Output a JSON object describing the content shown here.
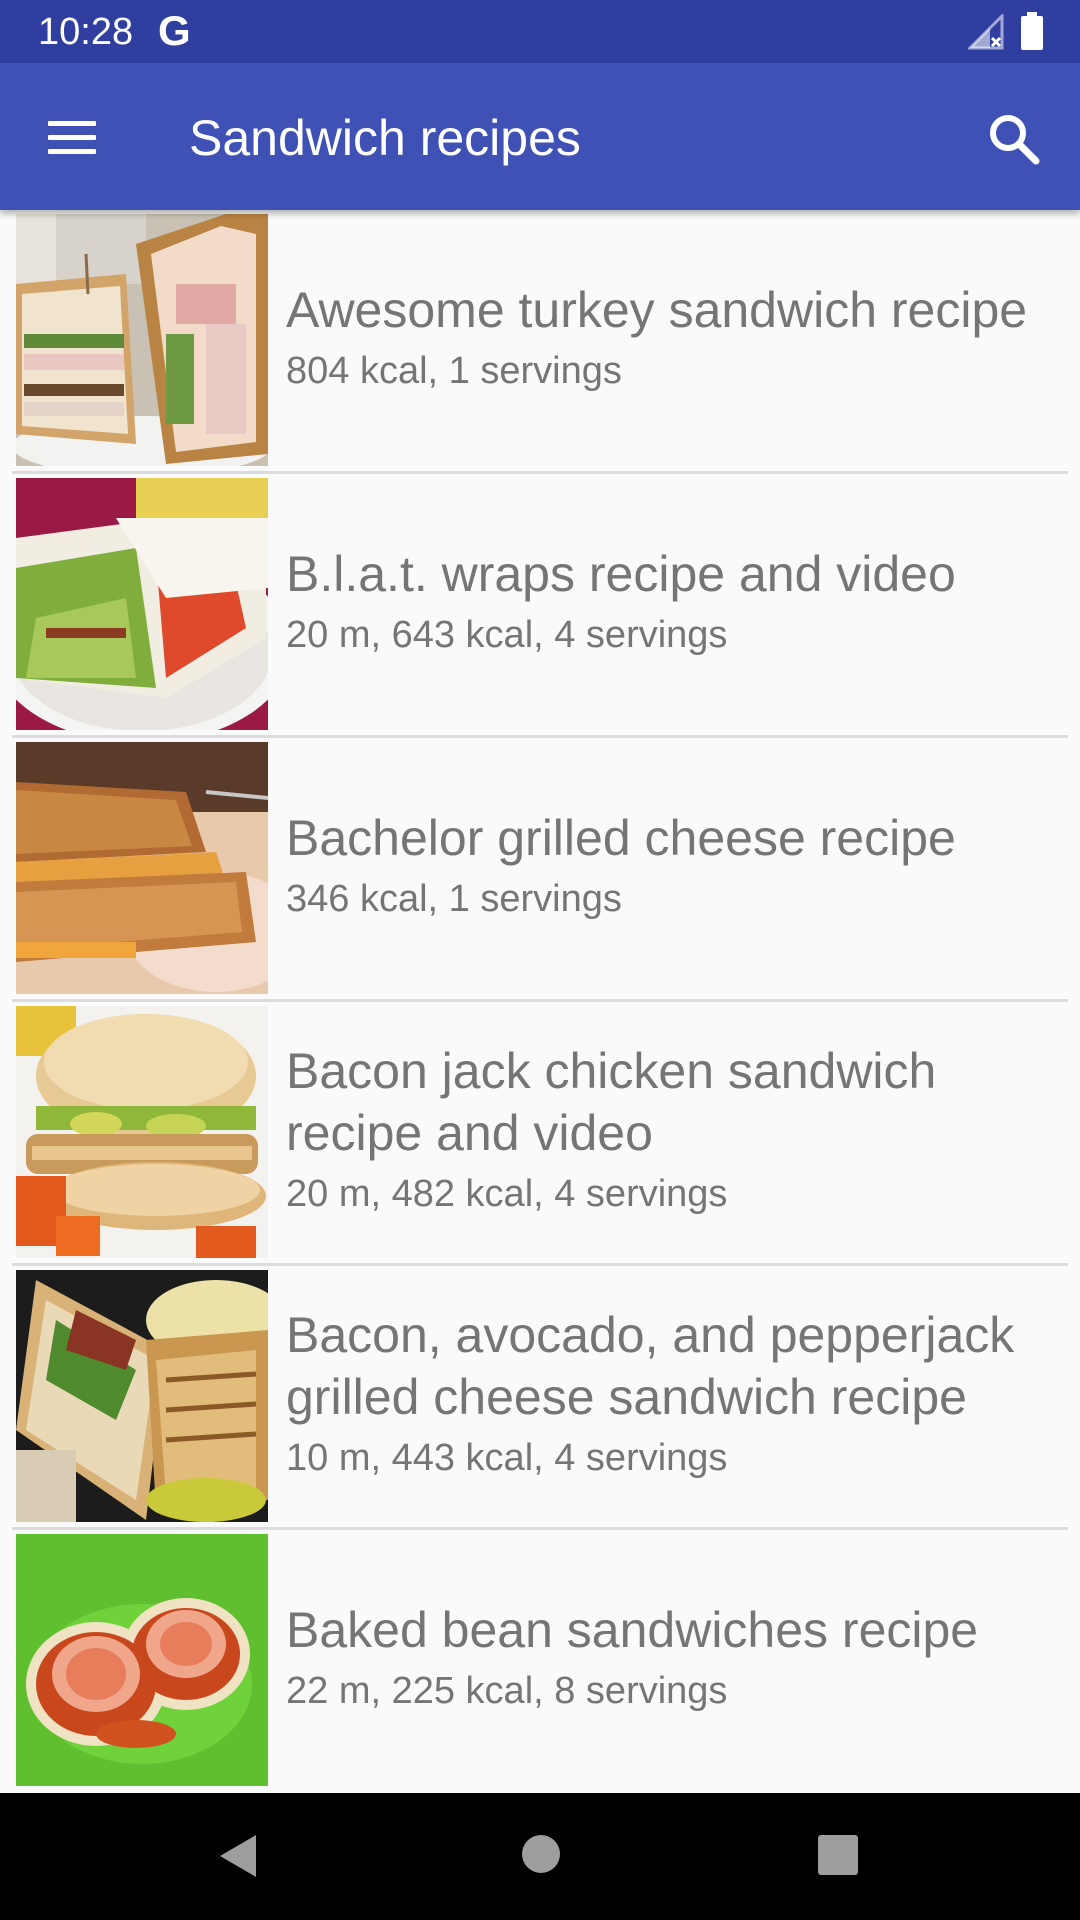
{
  "status_bar": {
    "time": "10:28",
    "google_indicator": "G",
    "icons": [
      "signal-icon",
      "battery-icon"
    ]
  },
  "app_bar": {
    "title": "Sandwich recipes",
    "menu_icon": "menu-icon",
    "search_icon": "search-icon"
  },
  "recipes": [
    {
      "title": "Awesome turkey sandwich recipe",
      "meta": "804 kcal, 1 servings",
      "image": "turkey-club-sandwich-image"
    },
    {
      "title": "B.l.a.t. wraps recipe and video",
      "meta": "20 m, 643 kcal, 4 servings",
      "image": "blat-wrap-image"
    },
    {
      "title": "Bachelor grilled cheese recipe",
      "meta": "346 kcal, 1 servings",
      "image": "grilled-cheese-image"
    },
    {
      "title": "Bacon jack chicken sandwich recipe and video",
      "meta": "20 m, 482 kcal, 4 servings",
      "image": "chicken-burger-image"
    },
    {
      "title": "Bacon, avocado, and pepperjack grilled cheese sandwich recipe",
      "meta": "10 m, 443 kcal, 4 servings",
      "image": "panini-sandwich-image"
    },
    {
      "title": "Baked bean sandwiches recipe",
      "meta": "22 m, 225 kcal, 8 servings",
      "image": "baked-bean-sandwich-image"
    }
  ],
  "colors": {
    "status_bar": "#303f9f",
    "app_bar": "#3f51b5",
    "list_background": "#fafafa",
    "text_secondary": "#757575",
    "divider": "#dcdcdc",
    "nav_bar": "#000000"
  },
  "nav_bar": {
    "buttons": [
      "back-icon",
      "home-icon",
      "recents-icon"
    ]
  }
}
